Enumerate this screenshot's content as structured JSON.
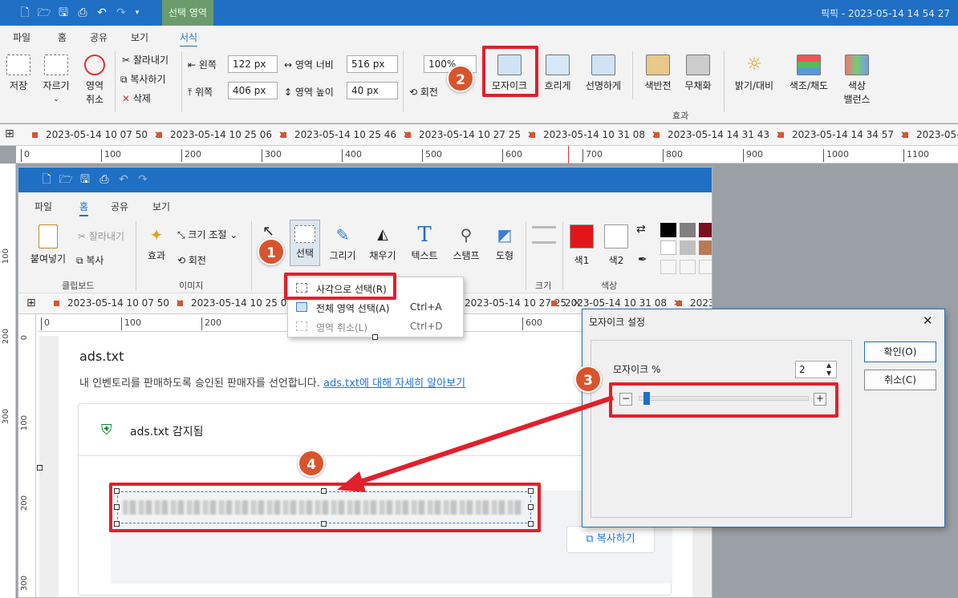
{
  "window": {
    "title": "픽픽 - 2023-05-14 14 54 27",
    "context_tab": "선택 영역"
  },
  "menu_tabs": [
    "파일",
    "홈",
    "공유",
    "보기",
    "서식"
  ],
  "ribbon": {
    "save": "저장",
    "crop": "자르기",
    "cancel_area_1": "영역",
    "cancel_area_2": "취소",
    "cut": "잘라내기",
    "copy": "복사하기",
    "delete": "삭제",
    "left_label": "왼쪽",
    "left_value": "122 px",
    "top_label": "위쪽",
    "top_value": "406 px",
    "width_label": "영역 너비",
    "width_value": "516 px",
    "height_label": "영역 높이",
    "height_value": "40 px",
    "zoom_value": "100%",
    "rotate": "회전",
    "effects": [
      "모자이크",
      "흐리게",
      "선명하게",
      "색반전",
      "무채화",
      "밝기/대비",
      "색조/채도"
    ],
    "color_balance_1": "색상",
    "color_balance_2": "밸런스",
    "effects_group": "효과"
  },
  "doc_tabs": [
    "2023-05-14 10 07 50",
    "2023-05-14 10 25 06",
    "2023-05-14 10 25 46",
    "2023-05-14 10 27 25",
    "2023-05-14 10 31 08",
    "2023-05-14 14 31 43",
    "2023-05-14 14 34 57",
    "2023-05-1"
  ],
  "ruler_h": [
    "0",
    "100",
    "200",
    "300",
    "400",
    "500",
    "600",
    "700",
    "800",
    "900",
    "1000",
    "1100"
  ],
  "ruler_v": [
    "100",
    "200",
    "300"
  ],
  "inner": {
    "menu_tabs": [
      "파일",
      "홈",
      "공유",
      "보기"
    ],
    "paste": "붙여넣기",
    "cut": "잘라내기",
    "copy": "복사",
    "clipboard_group": "클립보드",
    "effect": "효과",
    "resize": "크기 조절",
    "rotate": "회전",
    "image_group": "이미지",
    "select": "선택",
    "draw": "그리기",
    "fill": "채우기",
    "text": "텍스트",
    "stamp": "스탬프",
    "shape": "도형",
    "size": "크기",
    "color1": "색1",
    "color2": "색2",
    "color_group": "색상",
    "doc_tabs": [
      "2023-05-14 10 07 50",
      "2023-05-14 10 25 06",
      "2023-05-14 10 27 25",
      "2023-05-14 10 31 08",
      "2023-"
    ],
    "ruler_h": [
      "0",
      "100",
      "200",
      "600"
    ],
    "ruler_v": [
      "0",
      "100",
      "200",
      "300",
      "400"
    ],
    "dropdown": {
      "rect_select": "사각으로 선택(R)",
      "select_all": "전체 영역 선택(A)",
      "select_all_shortcut": "Ctrl+A",
      "deselect": "영역 취소(L)",
      "deselect_shortcut": "Ctrl+D"
    },
    "web": {
      "heading": "ads.txt",
      "desc": "내 인벤토리를 판매하도록 승인된 판매자를 선언합니다.",
      "link": "ads.txt에 대해 자세히 알아보기",
      "status": "ads.txt 감지됨",
      "copy_button": "복사하기"
    }
  },
  "dialog": {
    "title": "모자이크 설정",
    "mosaic_label": "모자이크 %",
    "mosaic_value": "2",
    "ok": "확인(O)",
    "cancel": "취소(C)"
  },
  "badges": [
    "1",
    "2",
    "3",
    "4"
  ],
  "colors": {
    "accent": "#1f6fc5",
    "highlight_red": "#e0202a",
    "badge_orange": "#d9542c"
  }
}
